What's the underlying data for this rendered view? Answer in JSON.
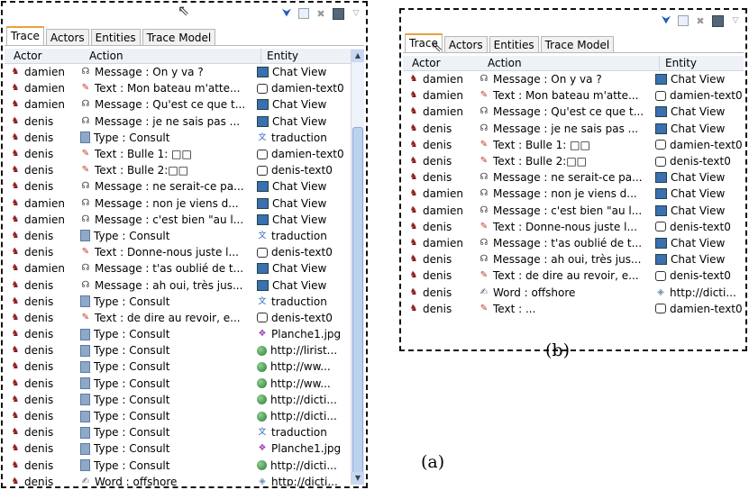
{
  "panel_a": {
    "tabs": [
      "Trace",
      "Actors",
      "Entities",
      "Trace Model"
    ],
    "columns": {
      "actor": "Actor",
      "action": "Action",
      "entity": "Entity"
    },
    "rows": [
      {
        "actor": "damien",
        "actor_icon": "person-icon",
        "action": "Message : On y va ?",
        "action_icon": "message-icon",
        "entity": "Chat View",
        "entity_icon": "chat-view-icon"
      },
      {
        "actor": "damien",
        "actor_icon": "person-icon",
        "action": "Text : Mon bateau m'atte...",
        "action_icon": "pencil-icon",
        "entity": "damien-text0",
        "entity_icon": "textbox-icon"
      },
      {
        "actor": "damien",
        "actor_icon": "person-icon",
        "action": "Message : Qu'est ce que t...",
        "action_icon": "message-icon",
        "entity": "Chat View",
        "entity_icon": "chat-view-icon"
      },
      {
        "actor": "denis",
        "actor_icon": "person-icon",
        "action": "Message : je ne sais pas ...",
        "action_icon": "message-icon",
        "entity": "Chat View",
        "entity_icon": "chat-view-icon"
      },
      {
        "actor": "denis",
        "actor_icon": "person-icon",
        "action": "Type : Consult",
        "action_icon": "document-icon",
        "entity": "traduction",
        "entity_icon": "translation-icon"
      },
      {
        "actor": "denis",
        "actor_icon": "person-icon",
        "action": "Text : Bulle 1: □□",
        "action_icon": "pencil-icon",
        "entity": "damien-text0",
        "entity_icon": "textbox-icon"
      },
      {
        "actor": "denis",
        "actor_icon": "person-icon",
        "action": "Text : Bulle 2:□□",
        "action_icon": "pencil-icon",
        "entity": "denis-text0",
        "entity_icon": "textbox-icon"
      },
      {
        "actor": "denis",
        "actor_icon": "person-icon",
        "action": "Message : ne serait-ce pa...",
        "action_icon": "message-icon",
        "entity": "Chat View",
        "entity_icon": "chat-view-icon"
      },
      {
        "actor": "damien",
        "actor_icon": "person-icon",
        "action": "Message : non je viens d...",
        "action_icon": "message-icon",
        "entity": "Chat View",
        "entity_icon": "chat-view-icon"
      },
      {
        "actor": "damien",
        "actor_icon": "person-icon",
        "action": "Message : c'est bien \"au l...",
        "action_icon": "message-icon",
        "entity": "Chat View",
        "entity_icon": "chat-view-icon"
      },
      {
        "actor": "denis",
        "actor_icon": "person-icon",
        "action": "Type : Consult",
        "action_icon": "document-icon",
        "entity": "traduction",
        "entity_icon": "translation-icon"
      },
      {
        "actor": "denis",
        "actor_icon": "person-icon",
        "action": "Text : Donne-nous juste l...",
        "action_icon": "pencil-icon",
        "entity": "denis-text0",
        "entity_icon": "textbox-icon"
      },
      {
        "actor": "damien",
        "actor_icon": "person-icon",
        "action": "Message : t'as oublié de t...",
        "action_icon": "message-icon",
        "entity": "Chat View",
        "entity_icon": "chat-view-icon"
      },
      {
        "actor": "denis",
        "actor_icon": "person-icon",
        "action": "Message : ah oui, très jus...",
        "action_icon": "message-icon",
        "entity": "Chat View",
        "entity_icon": "chat-view-icon"
      },
      {
        "actor": "denis",
        "actor_icon": "person-icon",
        "action": "Type : Consult",
        "action_icon": "document-icon",
        "entity": "traduction",
        "entity_icon": "translation-icon"
      },
      {
        "actor": "denis",
        "actor_icon": "person-icon",
        "action": "Text : de dire au revoir, e...",
        "action_icon": "pencil-icon",
        "entity": "denis-text0",
        "entity_icon": "textbox-icon"
      },
      {
        "actor": "denis",
        "actor_icon": "person-icon",
        "action": "Type : Consult",
        "action_icon": "document-icon",
        "entity": "Planche1.jpg",
        "entity_icon": "image-icon"
      },
      {
        "actor": "denis",
        "actor_icon": "person-icon",
        "action": "Type : Consult",
        "action_icon": "document-icon",
        "entity": "http://lirist...",
        "entity_icon": "globe-icon"
      },
      {
        "actor": "denis",
        "actor_icon": "person-icon",
        "action": "Type : Consult",
        "action_icon": "document-icon",
        "entity": "http://ww...",
        "entity_icon": "globe-icon"
      },
      {
        "actor": "denis",
        "actor_icon": "person-icon",
        "action": "Type : Consult",
        "action_icon": "document-icon",
        "entity": "http://ww...",
        "entity_icon": "globe-icon"
      },
      {
        "actor": "denis",
        "actor_icon": "person-icon",
        "action": "Type : Consult",
        "action_icon": "document-icon",
        "entity": "http://dicti...",
        "entity_icon": "globe-icon"
      },
      {
        "actor": "denis",
        "actor_icon": "person-icon",
        "action": "Type : Consult",
        "action_icon": "document-icon",
        "entity": "http://dicti...",
        "entity_icon": "globe-icon"
      },
      {
        "actor": "denis",
        "actor_icon": "person-icon",
        "action": "Type : Consult",
        "action_icon": "document-icon",
        "entity": "traduction",
        "entity_icon": "translation-icon"
      },
      {
        "actor": "denis",
        "actor_icon": "person-icon",
        "action": "Type : Consult",
        "action_icon": "document-icon",
        "entity": "Planche1.jpg",
        "entity_icon": "image-icon"
      },
      {
        "actor": "denis",
        "actor_icon": "person-icon",
        "action": "Type : Consult",
        "action_icon": "document-icon",
        "entity": "http://dicti...",
        "entity_icon": "globe-icon"
      },
      {
        "actor": "denis",
        "actor_icon": "person-icon",
        "action": "Word : offshore",
        "action_icon": "word-icon",
        "entity": "http://dicti...",
        "entity_icon": "link-icon"
      }
    ],
    "caption": "(a)"
  },
  "panel_b": {
    "tabs": [
      "Trace",
      "Actors",
      "Entities",
      "Trace Model"
    ],
    "columns": {
      "actor": "Actor",
      "action": "Action",
      "entity": "Entity"
    },
    "rows": [
      {
        "actor": "damien",
        "actor_icon": "person-icon",
        "action": "Message : On y va ?",
        "action_icon": "message-icon",
        "entity": "Chat View",
        "entity_icon": "chat-view-icon"
      },
      {
        "actor": "damien",
        "actor_icon": "person-icon",
        "action": "Text : Mon bateau m'atte...",
        "action_icon": "pencil-icon",
        "entity": "damien-text0",
        "entity_icon": "textbox-icon"
      },
      {
        "actor": "damien",
        "actor_icon": "person-icon",
        "action": "Message : Qu'est ce que t...",
        "action_icon": "message-icon",
        "entity": "Chat View",
        "entity_icon": "chat-view-icon"
      },
      {
        "actor": "denis",
        "actor_icon": "person-icon",
        "action": "Message : je ne sais pas ...",
        "action_icon": "message-icon",
        "entity": "Chat View",
        "entity_icon": "chat-view-icon"
      },
      {
        "actor": "denis",
        "actor_icon": "person-icon",
        "action": "Text : Bulle 1: □□",
        "action_icon": "pencil-icon",
        "entity": "damien-text0",
        "entity_icon": "textbox-icon"
      },
      {
        "actor": "denis",
        "actor_icon": "person-icon",
        "action": "Text : Bulle 2:□□",
        "action_icon": "pencil-icon",
        "entity": "denis-text0",
        "entity_icon": "textbox-icon"
      },
      {
        "actor": "denis",
        "actor_icon": "person-icon",
        "action": "Message : ne serait-ce pa...",
        "action_icon": "message-icon",
        "entity": "Chat View",
        "entity_icon": "chat-view-icon"
      },
      {
        "actor": "damien",
        "actor_icon": "person-icon",
        "action": "Message : non je viens d...",
        "action_icon": "message-icon",
        "entity": "Chat View",
        "entity_icon": "chat-view-icon"
      },
      {
        "actor": "damien",
        "actor_icon": "person-icon",
        "action": "Message : c'est bien \"au l...",
        "action_icon": "message-icon",
        "entity": "Chat View",
        "entity_icon": "chat-view-icon"
      },
      {
        "actor": "denis",
        "actor_icon": "person-icon",
        "action": "Text : Donne-nous juste l...",
        "action_icon": "pencil-icon",
        "entity": "denis-text0",
        "entity_icon": "textbox-icon"
      },
      {
        "actor": "damien",
        "actor_icon": "person-icon",
        "action": "Message : t'as oublié de t...",
        "action_icon": "message-icon",
        "entity": "Chat View",
        "entity_icon": "chat-view-icon"
      },
      {
        "actor": "denis",
        "actor_icon": "person-icon",
        "action": "Message : ah oui, très jus...",
        "action_icon": "message-icon",
        "entity": "Chat View",
        "entity_icon": "chat-view-icon"
      },
      {
        "actor": "denis",
        "actor_icon": "person-icon",
        "action": "Text : de dire au revoir, e...",
        "action_icon": "pencil-icon",
        "entity": "denis-text0",
        "entity_icon": "textbox-icon"
      },
      {
        "actor": "denis",
        "actor_icon": "person-icon",
        "action": "Word : offshore",
        "action_icon": "word-icon",
        "entity": "http://dicti...",
        "entity_icon": "link-icon"
      },
      {
        "actor": "denis",
        "actor_icon": "person-icon",
        "action": "Text : ...",
        "action_icon": "pencil-icon",
        "entity": "damien-text0",
        "entity_icon": "textbox-icon"
      }
    ],
    "caption": "(b)"
  },
  "toolbar_icons": [
    "filter-icon",
    "columns-icon",
    "close-icon",
    "save-icon",
    "view-menu-icon"
  ],
  "colors": {
    "active_tab_accent": "#e8a23c",
    "header_bg": "#eef2f6",
    "scrollbar": "#bcd0f0"
  }
}
